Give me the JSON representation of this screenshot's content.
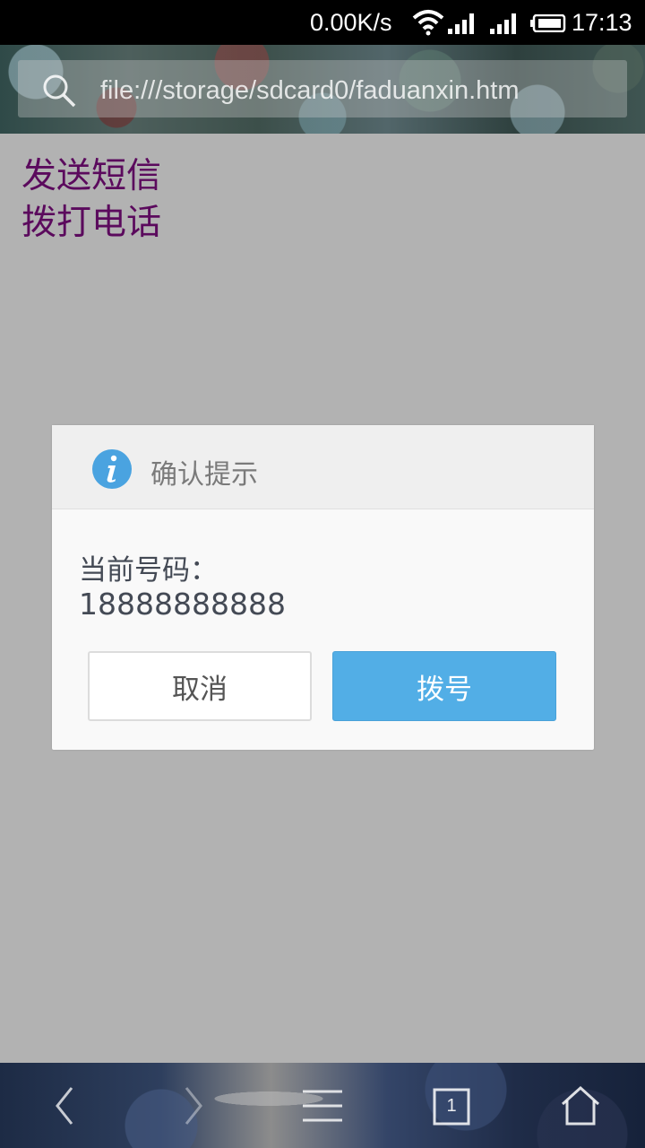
{
  "status_bar": {
    "speed": "0.00K/s",
    "time": "17:13"
  },
  "browser": {
    "url": "file:///storage/sdcard0/faduanxin.htm"
  },
  "page": {
    "links": [
      {
        "label": "发送短信"
      },
      {
        "label": "拨打电话"
      }
    ]
  },
  "dialog": {
    "title": "确认提示",
    "message": "当前号码：",
    "number": "18888888888",
    "cancel_label": "取消",
    "confirm_label": "拨号"
  },
  "bottom_nav": {
    "tab_count": "1"
  },
  "colors": {
    "page_background": "#b2b2b2",
    "link": "#5b0a5d",
    "info_icon": "#4aa3e0",
    "confirm_button": "#52aee6"
  },
  "icons": [
    "search-icon",
    "wifi-icon",
    "signal-icon",
    "battery-icon",
    "info-icon",
    "back-icon",
    "forward-icon",
    "menu-icon",
    "tabs-icon",
    "home-icon"
  ]
}
